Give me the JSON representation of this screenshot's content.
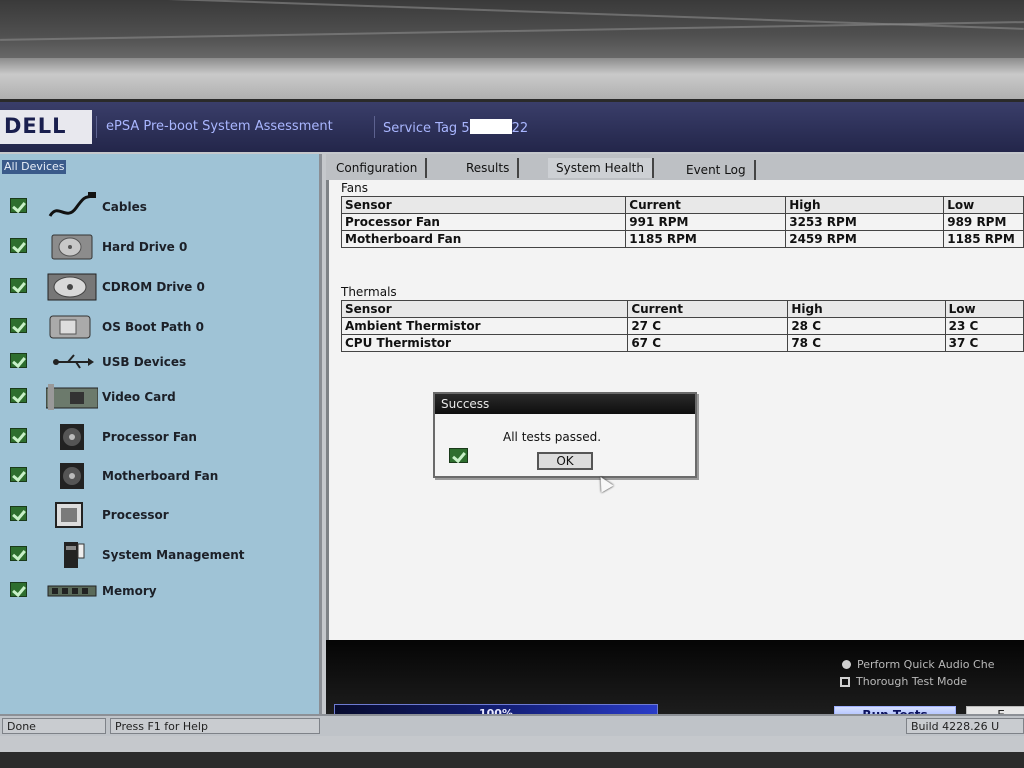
{
  "header": {
    "logo": "DELL",
    "title": "ePSA Pre-boot System Assessment",
    "service_tag_prefix": "Service Tag 5",
    "service_tag_suffix": "22"
  },
  "left_panel": {
    "heading": "All Devices",
    "devices": [
      {
        "label": "Cables",
        "icon": "cable-icon",
        "status": "passed"
      },
      {
        "label": "Hard Drive 0",
        "icon": "hard-drive-icon",
        "status": "passed"
      },
      {
        "label": "CDROM Drive 0",
        "icon": "cdrom-icon",
        "status": "passed"
      },
      {
        "label": "OS Boot Path 0",
        "icon": "boot-path-icon",
        "status": "passed"
      },
      {
        "label": "USB Devices",
        "icon": "usb-icon",
        "status": "passed"
      },
      {
        "label": "Video Card",
        "icon": "video-card-icon",
        "status": "passed"
      },
      {
        "label": "Processor Fan",
        "icon": "fan-icon",
        "status": "passed"
      },
      {
        "label": "Motherboard Fan",
        "icon": "fan-icon",
        "status": "passed"
      },
      {
        "label": "Processor",
        "icon": "processor-icon",
        "status": "passed"
      },
      {
        "label": "System Management",
        "icon": "system-management-icon",
        "status": "passed"
      },
      {
        "label": "Memory",
        "icon": "memory-icon",
        "status": "passed"
      }
    ]
  },
  "tabs": [
    {
      "label": "Configuration"
    },
    {
      "label": "Results"
    },
    {
      "label": "System Health"
    },
    {
      "label": "Event Log"
    }
  ],
  "active_tab": "System Health",
  "fans": {
    "title": "Fans",
    "columns": [
      "Sensor",
      "Current",
      "High",
      "Low"
    ],
    "rows": [
      [
        "Processor Fan",
        "991 RPM",
        "3253 RPM",
        "989 RPM"
      ],
      [
        "Motherboard Fan",
        "1185 RPM",
        "2459 RPM",
        "1185 RPM"
      ]
    ]
  },
  "thermals": {
    "title": "Thermals",
    "columns": [
      "Sensor",
      "Current",
      "High",
      "Low"
    ],
    "rows": [
      [
        "Ambient Thermistor",
        "27 C",
        "28 C",
        "23 C"
      ],
      [
        "CPU Thermistor",
        "67 C",
        "78 C",
        "37 C"
      ]
    ]
  },
  "dialog": {
    "title": "Success",
    "message": "All tests passed.",
    "ok_label": "OK"
  },
  "options": {
    "quick_audio": "Perform Quick Audio Che",
    "thorough": "Thorough Test Mode"
  },
  "progress": {
    "value": 1.0,
    "label": "100%"
  },
  "buttons": {
    "run": "Run Tests",
    "exit": "E"
  },
  "status_bar": {
    "state": "Done",
    "help": "Press F1 for Help",
    "build": "Build  4228.26 U"
  },
  "colors": {
    "header_bg": "#23264a",
    "panel_bg": "#9fc3d6",
    "check_green": "#2e6e2e",
    "progress_blue": "#2a3cc8"
  }
}
